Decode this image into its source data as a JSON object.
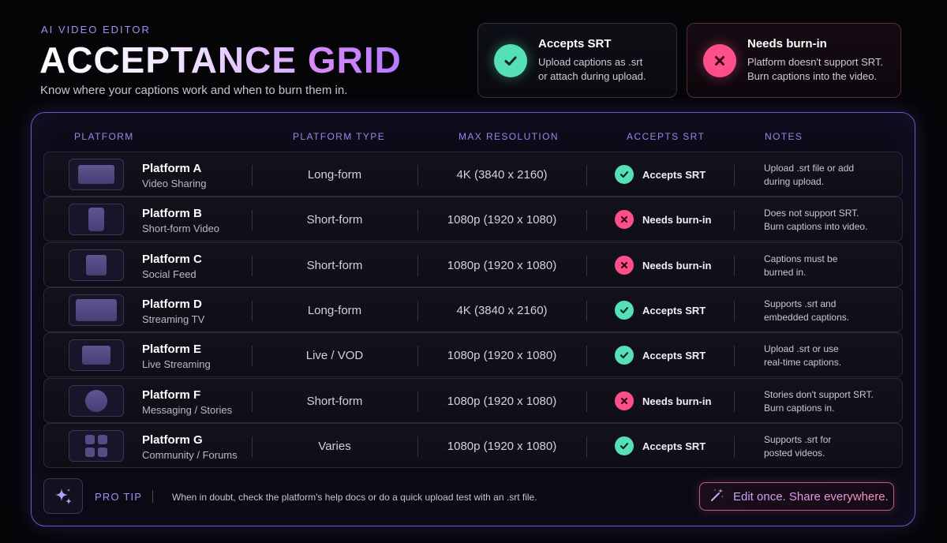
{
  "header": {
    "eyebrow": "AI VIDEO EDITOR",
    "title_part1": "ACCEPTANCE ",
    "title_part2": "GRID",
    "subtitle": "Know where your captions work and when to burn them in."
  },
  "legend": {
    "accept": {
      "title": "Accepts SRT",
      "line1": "Upload captions as .srt",
      "line2": "or attach during upload.",
      "icon": "check-circle-icon",
      "color": "#56e0b8"
    },
    "burn": {
      "title": "Needs burn-in",
      "line1": "Platform doesn't support SRT.",
      "line2": "Burn captions into the video.",
      "icon": "x-circle-icon",
      "color": "#ff4f8b"
    }
  },
  "table": {
    "columns": [
      "PLATFORM",
      "PLATFORM TYPE",
      "MAX RESOLUTION",
      "ACCEPTS SRT",
      "NOTES"
    ],
    "rows": [
      {
        "name": "Platform A",
        "category": "Video Sharing",
        "type": "Long-form",
        "resolution": "4K (3840 x 2160)",
        "status": "Accepts SRT",
        "accepts": true,
        "notes": [
          "Upload .srt file or add",
          "during upload."
        ],
        "thumb": "wide"
      },
      {
        "name": "Platform B",
        "category": "Short-form Video",
        "type": "Short-form",
        "resolution": "1080p (1920 x 1080)",
        "status": "Needs burn-in",
        "accepts": false,
        "notes": [
          "Does not support SRT.",
          "Burn captions into video."
        ],
        "thumb": "portrait"
      },
      {
        "name": "Platform C",
        "category": "Social Feed",
        "type": "Short-form",
        "resolution": "1080p (1920 x 1080)",
        "status": "Needs burn-in",
        "accepts": false,
        "notes": [
          "Captions must be",
          "burned in."
        ],
        "thumb": "square"
      },
      {
        "name": "Platform D",
        "category": "Streaming TV",
        "type": "Long-form",
        "resolution": "4K (3840 x 2160)",
        "status": "Accepts SRT",
        "accepts": true,
        "notes": [
          "Supports .srt and",
          "embedded captions."
        ],
        "thumb": "tv"
      },
      {
        "name": "Platform E",
        "category": "Live Streaming",
        "type": "Live / VOD",
        "resolution": "1080p (1920 x 1080)",
        "status": "Accepts SRT",
        "accepts": true,
        "notes": [
          "Upload .srt or use",
          "real-time captions."
        ],
        "thumb": "landscape"
      },
      {
        "name": "Platform F",
        "category": "Messaging / Stories",
        "type": "Short-form",
        "resolution": "1080p (1920 x 1080)",
        "status": "Needs burn-in",
        "accepts": false,
        "notes": [
          "Stories don't support SRT.",
          "Burn captions in."
        ],
        "thumb": "circle"
      },
      {
        "name": "Platform G",
        "category": "Community / Forums",
        "type": "Varies",
        "resolution": "1080p (1920 x 1080)",
        "status": "Accepts SRT",
        "accepts": true,
        "notes": [
          "Supports .srt for",
          "posted videos."
        ],
        "thumb": "grid"
      }
    ]
  },
  "footer": {
    "tip_label": "PRO TIP",
    "tip_text": "When in doubt, check the platform's help docs or do a quick upload test with an .srt file.",
    "cta_label": "Edit once. Share everywhere.",
    "tip_icon": "sparkles-icon",
    "cta_icon": "magic-wand-icon"
  }
}
